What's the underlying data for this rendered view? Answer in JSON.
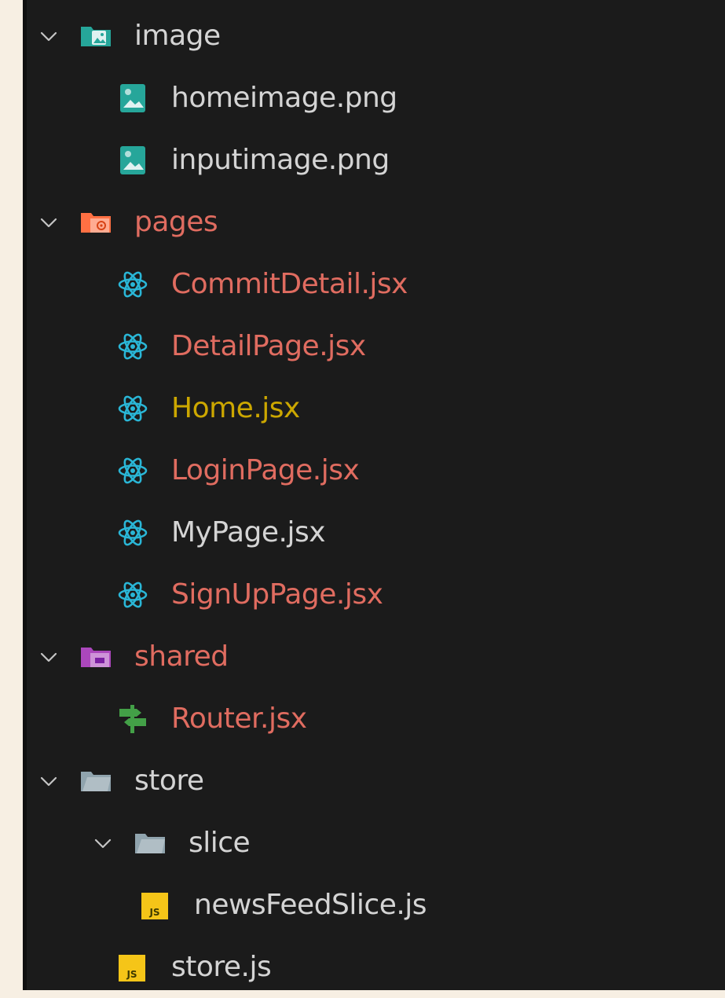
{
  "colors": {
    "background": "#1b1b1b",
    "text_default": "#d4d4d4",
    "text_modified": "#e06c60",
    "text_untracked": "#cca700",
    "react_icon": "#2ab6d6",
    "image_icon": "#26a69a",
    "pages_folder_icon": "#ff7043",
    "shared_folder_icon": "#ab47bc",
    "router_icon": "#43a047",
    "js_icon": "#f5c518",
    "plain_folder_icon": "#90a4ae"
  },
  "tree": [
    {
      "name": "image",
      "kind": "folder",
      "icon": "image-folder-icon",
      "expanded": true,
      "depth": 0,
      "status": "default"
    },
    {
      "name": "homeimage.png",
      "kind": "file",
      "icon": "image-file-icon",
      "depth": 1,
      "status": "default"
    },
    {
      "name": "inputimage.png",
      "kind": "file",
      "icon": "image-file-icon",
      "depth": 1,
      "status": "default"
    },
    {
      "name": "pages",
      "kind": "folder",
      "icon": "pages-folder-icon",
      "expanded": true,
      "depth": 0,
      "status": "modified"
    },
    {
      "name": "CommitDetail.jsx",
      "kind": "file",
      "icon": "react-icon",
      "depth": 1,
      "status": "modified"
    },
    {
      "name": "DetailPage.jsx",
      "kind": "file",
      "icon": "react-icon",
      "depth": 1,
      "status": "modified"
    },
    {
      "name": "Home.jsx",
      "kind": "file",
      "icon": "react-icon",
      "depth": 1,
      "status": "untracked"
    },
    {
      "name": "LoginPage.jsx",
      "kind": "file",
      "icon": "react-icon",
      "depth": 1,
      "status": "modified"
    },
    {
      "name": "MyPage.jsx",
      "kind": "file",
      "icon": "react-icon",
      "depth": 1,
      "status": "default"
    },
    {
      "name": "SignUpPage.jsx",
      "kind": "file",
      "icon": "react-icon",
      "depth": 1,
      "status": "modified"
    },
    {
      "name": "shared",
      "kind": "folder",
      "icon": "shared-folder-icon",
      "expanded": true,
      "depth": 0,
      "status": "modified"
    },
    {
      "name": "Router.jsx",
      "kind": "file",
      "icon": "router-icon",
      "depth": 1,
      "status": "modified"
    },
    {
      "name": "store",
      "kind": "folder",
      "icon": "folder-open-icon",
      "expanded": true,
      "depth": 0,
      "status": "default"
    },
    {
      "name": "slice",
      "kind": "folder",
      "icon": "folder-open-icon",
      "expanded": true,
      "depth": 1,
      "status": "default"
    },
    {
      "name": "newsFeedSlice.js",
      "kind": "file",
      "icon": "js-file-icon",
      "depth": 2,
      "status": "default"
    },
    {
      "name": "store.js",
      "kind": "file",
      "icon": "js-file-icon",
      "depth": 1,
      "status": "default"
    }
  ]
}
